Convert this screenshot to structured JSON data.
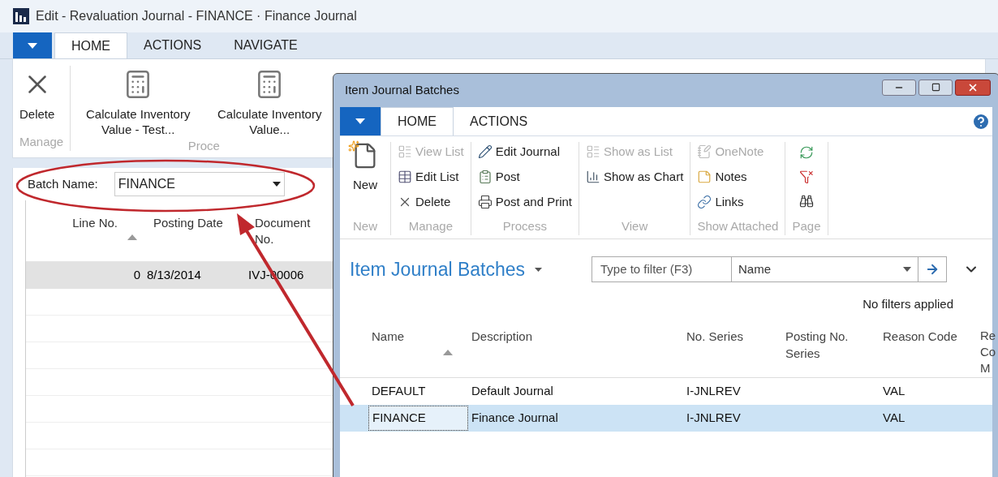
{
  "window": {
    "title": "Edit - Revaluation Journal - FINANCE · Finance Journal"
  },
  "tabs": [
    {
      "label": "HOME",
      "selected": true
    },
    {
      "label": "ACTIONS",
      "selected": false
    },
    {
      "label": "NAVIGATE",
      "selected": false
    }
  ],
  "ribbon": {
    "groups": [
      {
        "label": "Manage",
        "actions": [
          {
            "label": "Delete"
          }
        ]
      },
      {
        "label": "Proce",
        "actions": [
          {
            "label": "Calculate Inventory Value - Test..."
          },
          {
            "label": "Calculate Inventory Value..."
          }
        ]
      }
    ]
  },
  "batch": {
    "label": "Batch Name:",
    "value": "FINANCE"
  },
  "journal": {
    "columns": [
      {
        "label": "Line No.",
        "sorted": true
      },
      {
        "label": "Posting Date",
        "sorted": false
      },
      {
        "label": "Document No.",
        "sorted": false
      }
    ],
    "rows": [
      {
        "cells": [
          "0",
          "8/13/2014",
          "IVJ-00006"
        ],
        "selected": true
      }
    ]
  },
  "dialog": {
    "title": "Item Journal Batches",
    "tabs": [
      {
        "label": "HOME",
        "selected": true
      },
      {
        "label": "ACTIONS",
        "selected": false
      }
    ],
    "ribbon": {
      "groups": [
        {
          "label": "New",
          "kind": "large",
          "actions": [
            {
              "label": "New",
              "disabled": false
            }
          ]
        },
        {
          "label": "Manage",
          "kind": "small",
          "actions": [
            {
              "label": "View List",
              "disabled": true
            },
            {
              "label": "Edit List",
              "disabled": false
            },
            {
              "label": "Delete",
              "disabled": false
            }
          ]
        },
        {
          "label": "Process",
          "kind": "small",
          "actions": [
            {
              "label": "Edit Journal",
              "disabled": false
            },
            {
              "label": "Post",
              "disabled": false
            },
            {
              "label": "Post and Print",
              "disabled": false
            }
          ]
        },
        {
          "label": "View",
          "kind": "small",
          "actions": [
            {
              "label": "Show as List",
              "disabled": true
            },
            {
              "label": "Show as Chart",
              "disabled": false
            }
          ]
        },
        {
          "label": "Show Attached",
          "kind": "small",
          "actions": [
            {
              "label": "OneNote",
              "disabled": true
            },
            {
              "label": "Notes",
              "disabled": false
            },
            {
              "label": "Links",
              "disabled": false
            }
          ]
        },
        {
          "label": "Page",
          "kind": "icons",
          "actions": [
            {
              "disabled": false
            },
            {
              "disabled": false
            },
            {
              "disabled": false
            }
          ]
        }
      ]
    },
    "page_title": "Item Journal Batches",
    "filter": {
      "placeholder": "Type to filter (F3)",
      "field": "Name"
    },
    "filter_status": "No filters applied",
    "table": {
      "columns": [
        {
          "label": "Name",
          "sorted": true
        },
        {
          "label": "Description",
          "sorted": false
        },
        {
          "label": "No. Series",
          "sorted": false
        },
        {
          "label": "Posting No. Series",
          "sorted": false
        },
        {
          "label": "Reason Code",
          "sorted": false
        },
        {
          "label": "Re Co M"
        }
      ],
      "rows": [
        {
          "cells": [
            "DEFAULT",
            "Default Journal",
            "I-JNLREV",
            "",
            "VAL"
          ],
          "selected": false
        },
        {
          "cells": [
            "FINANCE",
            "Finance Journal",
            "I-JNLREV",
            "",
            "VAL"
          ],
          "selected": true
        }
      ]
    }
  }
}
